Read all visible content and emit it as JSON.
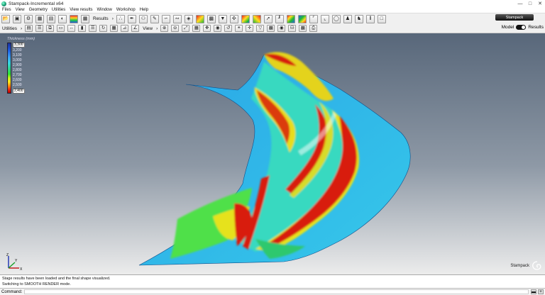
{
  "window": {
    "title": "Stampack-Incremental x64"
  },
  "menu": [
    "Files",
    "View",
    "Geometry",
    "Utilities",
    "View results",
    "Window",
    "Workshop",
    "Help"
  ],
  "toolbar_row1": {
    "results_label": "Results"
  },
  "toolbar_row2": {
    "utilities_label": "Utilities",
    "view_label": "View"
  },
  "brand": {
    "logo_text": "Stampack",
    "viewport_mark": "Stampack"
  },
  "mode_switch": {
    "left_label": "Model",
    "right_label": "Results",
    "selected": "Results"
  },
  "legend": {
    "title": "Thickness (mm)",
    "values": [
      "3,300",
      "3,200",
      "3,100",
      "3,000",
      "2,900",
      "2,800",
      "2,700",
      "2,600",
      "2,500",
      "2,400"
    ],
    "colors": [
      "#1a2f9c",
      "#1d5be0",
      "#3aa0f2",
      "#36d6e0",
      "#2fd48a",
      "#2ee32e",
      "#c8ef1a",
      "#ffe71a",
      "#ff8a0f",
      "#b40000"
    ]
  },
  "axis": {
    "x": "X",
    "y": "Y",
    "z": "Z"
  },
  "console": {
    "messages": [
      "Stage results have been loaded and the final shape visualized.",
      "Switching to SMOOTH RENDER mode."
    ]
  },
  "command": {
    "label": "Command:",
    "value": ""
  },
  "colors": {
    "background_top": "#58677a",
    "background_bottom": "#ececec",
    "part_base": "#2fb6e8",
    "part_hot": "#d81e10",
    "part_mid": "#4fe04a"
  }
}
